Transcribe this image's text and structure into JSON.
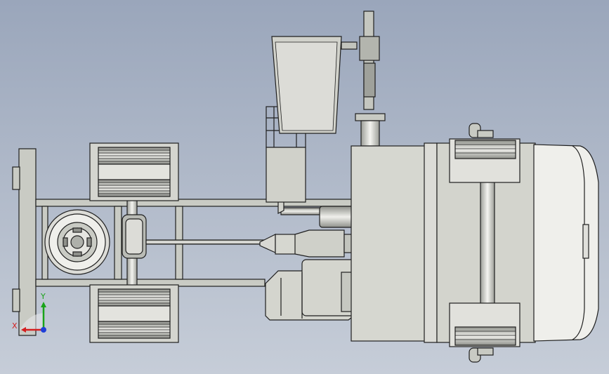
{
  "viewport": {
    "background_top": "#9aa6bb",
    "background_bottom": "#c6cdd8"
  },
  "colors": {
    "steel": "#c9cbc4",
    "steel_dark": "#a9aba4",
    "outline": "#1f1f1f",
    "tire": "#d8d9d3",
    "tire_dark": "#8e908a",
    "cab": "#d6d7d0",
    "white": "#f2f2ee"
  },
  "triad": {
    "x_label": "X",
    "y_label": "Y",
    "x_color": "#d42020",
    "y_color": "#19a319",
    "z_color": "#1f3fd8"
  }
}
